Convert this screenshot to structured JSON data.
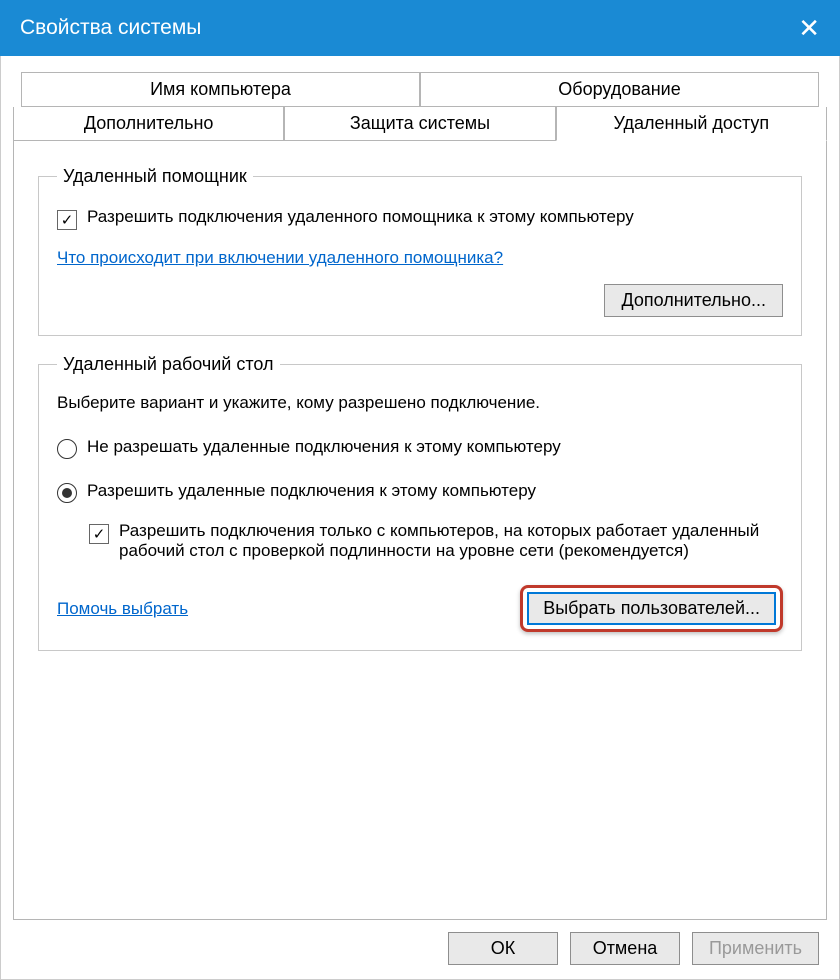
{
  "title": "Свойства системы",
  "tabs": {
    "computer_name": "Имя компьютера",
    "hardware": "Оборудование",
    "advanced": "Дополнительно",
    "protection": "Защита системы",
    "remote": "Удаленный доступ"
  },
  "remote_assist": {
    "legend": "Удаленный помощник",
    "allow": "Разрешить подключения удаленного помощника к этому компьютеру",
    "help_link": "Что происходит при включении удаленного помощника?",
    "advanced_btn": "Дополнительно..."
  },
  "remote_desktop": {
    "legend": "Удаленный рабочий стол",
    "prompt": "Выберите вариант и укажите, кому разрешено подключение.",
    "opt_disallow": "Не разрешать удаленные подключения к этому компьютеру",
    "opt_allow": "Разрешить удаленные подключения к этому компьютеру",
    "nla_check": "Разрешить подключения только с компьютеров, на которых работает удаленный рабочий стол с проверкой подлинности на уровне сети (рекомендуется)",
    "help_link": "Помочь выбрать",
    "select_users_btn": "Выбрать пользователей..."
  },
  "buttons": {
    "ok": "ОК",
    "cancel": "Отмена",
    "apply": "Применить"
  }
}
